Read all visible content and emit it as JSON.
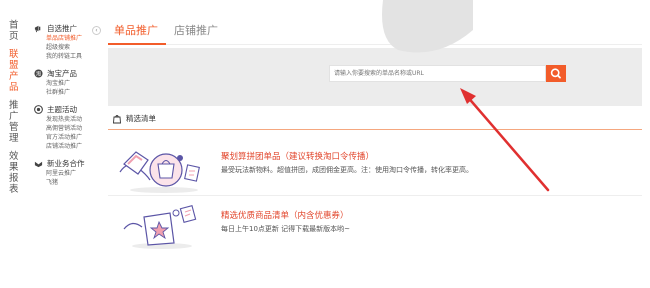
{
  "vnav": {
    "items": [
      {
        "label": "首页",
        "active": false
      },
      {
        "label": "联盟产品",
        "active": true
      },
      {
        "label": "推广管理",
        "active": false
      },
      {
        "label": "效果报表",
        "active": false
      }
    ]
  },
  "subnav": {
    "sections": [
      {
        "title": "自选推广",
        "icon": "megaphone-icon",
        "items": [
          {
            "label": "单品店铺推广",
            "active": true
          },
          {
            "label": "超级搜索"
          },
          {
            "label": "我的转链工具"
          }
        ]
      },
      {
        "title": "淘宝产品",
        "icon": "taobao-icon",
        "items": [
          {
            "label": "淘宝推广"
          },
          {
            "label": "社群推广"
          }
        ]
      },
      {
        "title": "主题活动",
        "icon": "target-icon",
        "items": [
          {
            "label": "发现热卖活动"
          },
          {
            "label": "高佣营销活动"
          },
          {
            "label": "官方活动推广"
          },
          {
            "label": "店铺活动推广"
          }
        ]
      },
      {
        "title": "新业务合作",
        "icon": "handshake-icon",
        "items": [
          {
            "label": "阿里云推广"
          },
          {
            "label": "飞猪"
          }
        ]
      }
    ]
  },
  "tabs": [
    {
      "label": "单品推广",
      "active": true
    },
    {
      "label": "店铺推广",
      "active": false
    }
  ],
  "search": {
    "placeholder": "请输入你要搜索的单品名称或URL",
    "button_icon": "search-icon"
  },
  "choice": {
    "title": "精选清单",
    "icon": "bag-icon"
  },
  "cards": [
    {
      "title": "聚划算拼团单品（建议转换淘口令传播）",
      "desc": "最受玩法新物料。超值拼团，成团佣金更高。注：使用淘口令传播，转化率更高。",
      "illustration": "team-buy-illustration"
    },
    {
      "title": "精选优质商品清单（内含优惠券）",
      "desc": "每日上午10点更新 记得下载最新版本哟~",
      "illustration": "star-box-illustration"
    }
  ],
  "colors": {
    "accent": "#f25c2a",
    "title_red": "#e2462c",
    "arrow_red": "#e03030",
    "band_gray": "#ececec",
    "illustration_purple": "#5b55a6"
  }
}
